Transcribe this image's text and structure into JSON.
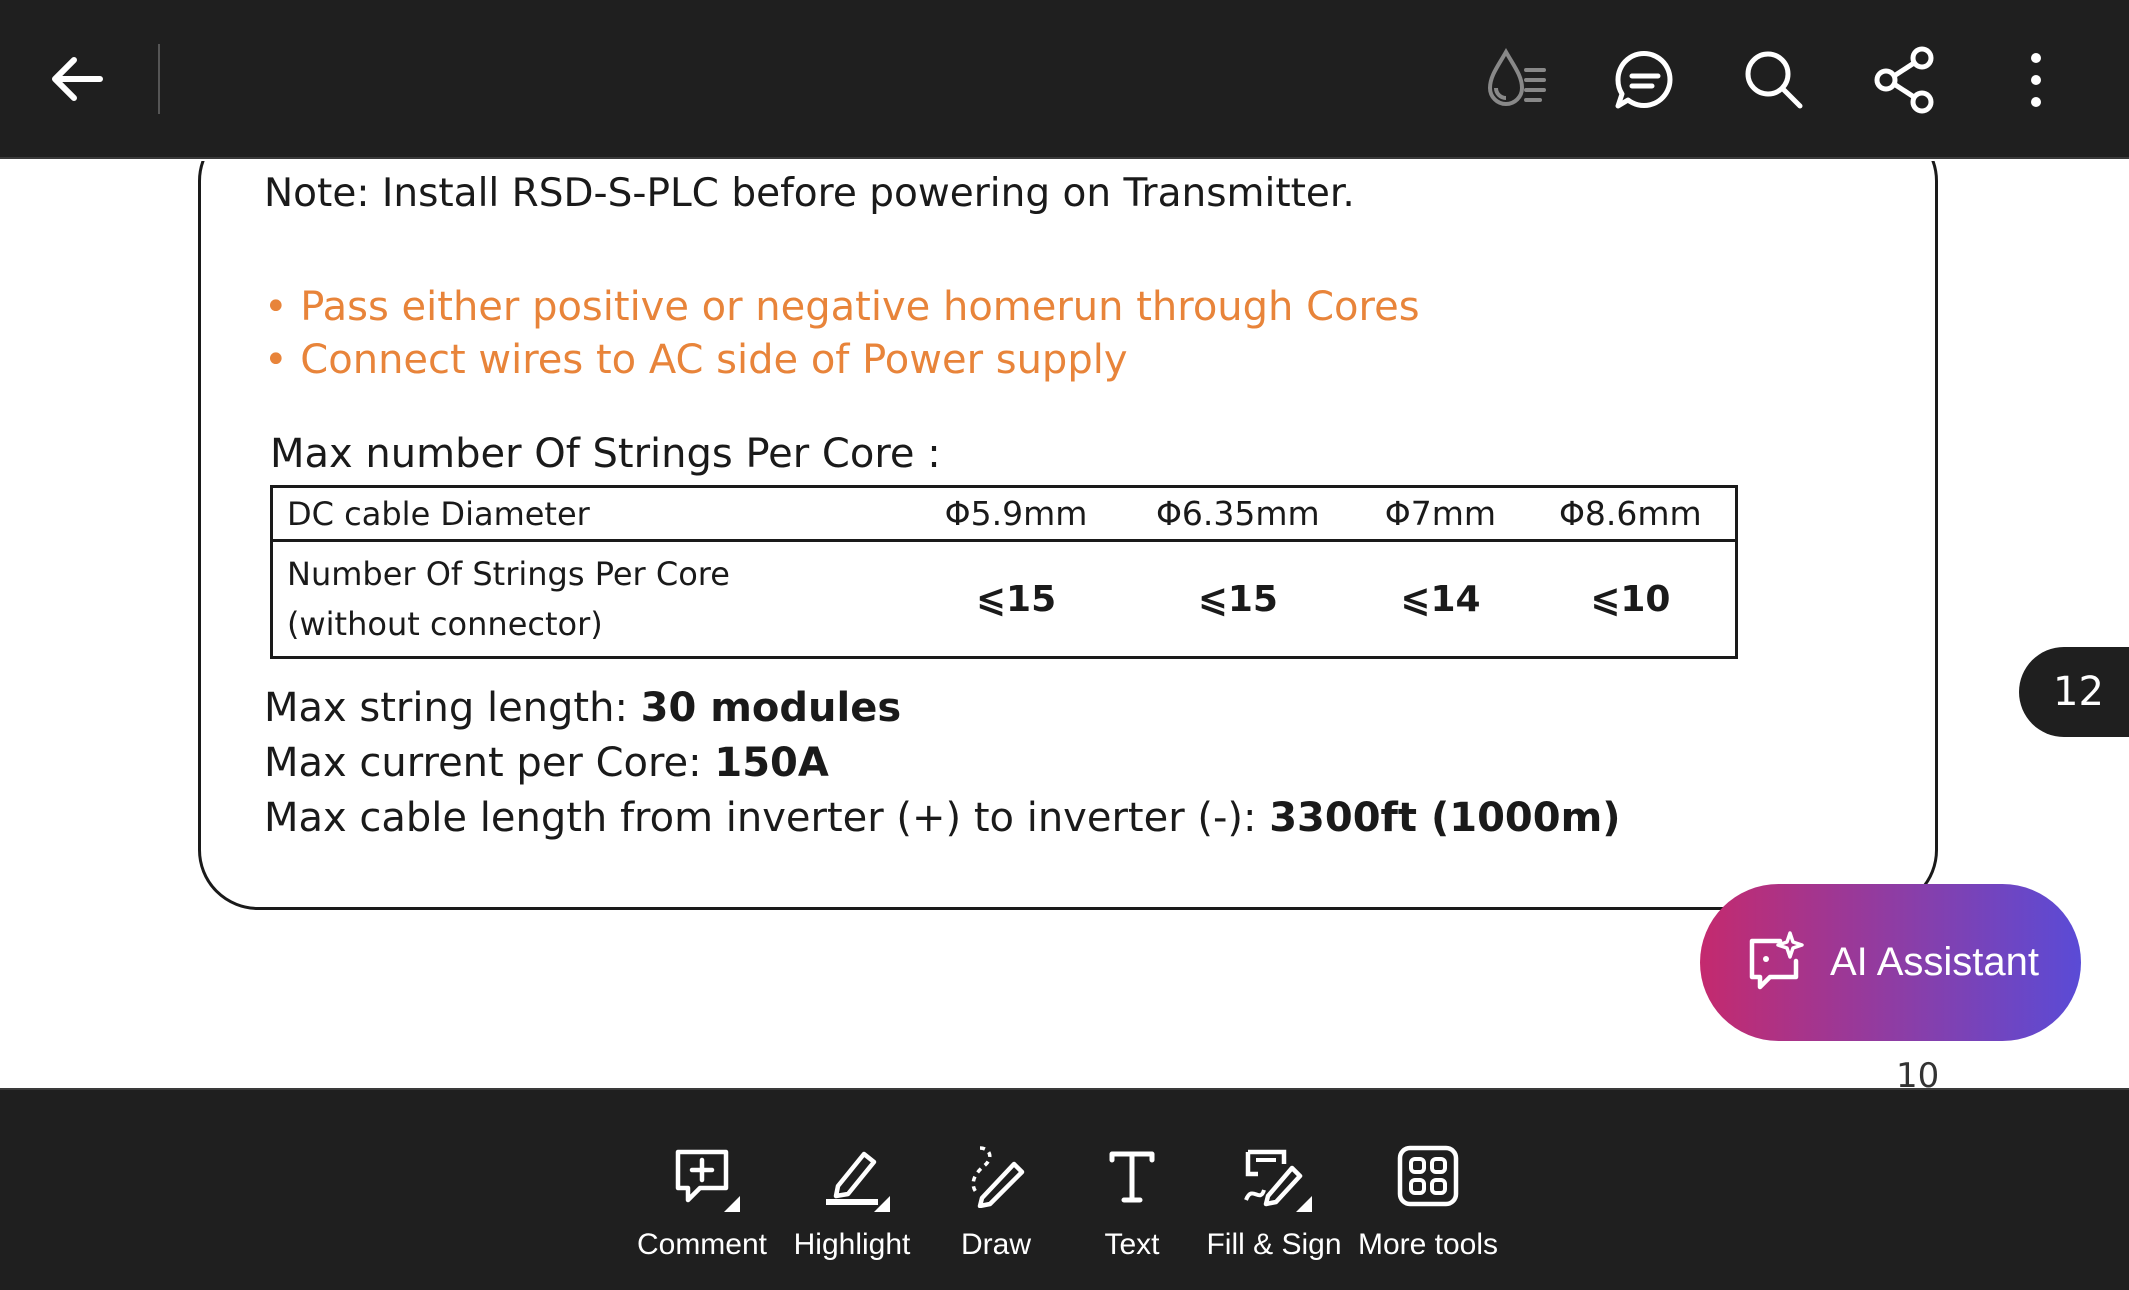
{
  "topbar": {
    "icons": [
      "back-arrow-icon",
      "liquid-mode-icon",
      "comments-icon",
      "search-icon",
      "share-icon",
      "more-vertical-icon"
    ]
  },
  "document": {
    "note": "Note: Install RSD-S-PLC before powering on Transmitter.",
    "bullets": [
      "• Pass either positive or negative homerun through Cores",
      "• Connect wires to AC side of Power supply"
    ],
    "table_caption": "Max number Of Strings Per Core :",
    "table": {
      "header_label": "DC cable Diameter",
      "diameters": [
        "Φ5.9mm",
        "Φ6.35mm",
        "Φ7mm",
        "Φ8.6mm"
      ],
      "row_label_line1": "Number Of Strings Per Core",
      "row_label_line2": "(without connector)",
      "strings": [
        "⩽15",
        "⩽15",
        "⩽14",
        "⩽10"
      ]
    },
    "specs": [
      {
        "label": "Max string length: ",
        "value": "30 modules"
      },
      {
        "label": "Max current per Core: ",
        "value": "150A"
      },
      {
        "label": "Max cable length from inverter (+) to inverter (-): ",
        "value": "3300ft (1000m)"
      }
    ],
    "page_number": "10"
  },
  "page_badge": "12",
  "ai_assistant": {
    "label": "AI Assistant"
  },
  "toolbar": {
    "tools": [
      {
        "label": "Comment",
        "icon": "comment-icon"
      },
      {
        "label": "Highlight",
        "icon": "highlight-icon"
      },
      {
        "label": "Draw",
        "icon": "draw-icon"
      },
      {
        "label": "Text",
        "icon": "text-icon"
      },
      {
        "label": "Fill & Sign",
        "icon": "fill-sign-icon"
      },
      {
        "label": "More tools",
        "icon": "more-tools-icon"
      }
    ]
  },
  "colors": {
    "bar_bg": "#1f1f1f",
    "bullet_orange": "#e8843a",
    "ai_gradient_start": "#c42a6e",
    "ai_gradient_end": "#5a4bd6"
  }
}
